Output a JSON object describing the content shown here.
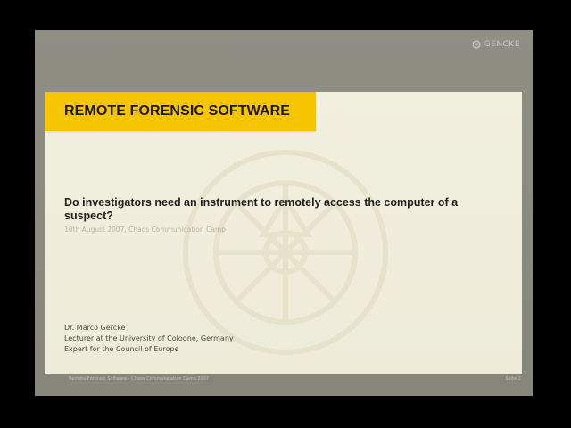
{
  "brand": {
    "name": "GENCKE"
  },
  "slide": {
    "title": "REMOTE FORENSIC SOFTWARE",
    "question": "Do investigators need an instrument to remotely access the computer of a suspect?",
    "dateline": "10th August 2007, Chaos Communication Camp",
    "author": {
      "name": "Dr. Marco Gercke",
      "role": "Lecturer at the University of Cologne, Germany",
      "affiliation": "Expert for the Council of Europe"
    }
  },
  "footer": {
    "left": "Remote Forensic Software - Chaos Communication Camp 2007",
    "right": "Seite 1"
  },
  "colors": {
    "accent": "#f5c600",
    "slide_bg": "#f1efde",
    "frame": "#8f8f84"
  },
  "icons": {
    "brand": "brand-logo-icon",
    "watermark": "seal-watermark-icon"
  }
}
